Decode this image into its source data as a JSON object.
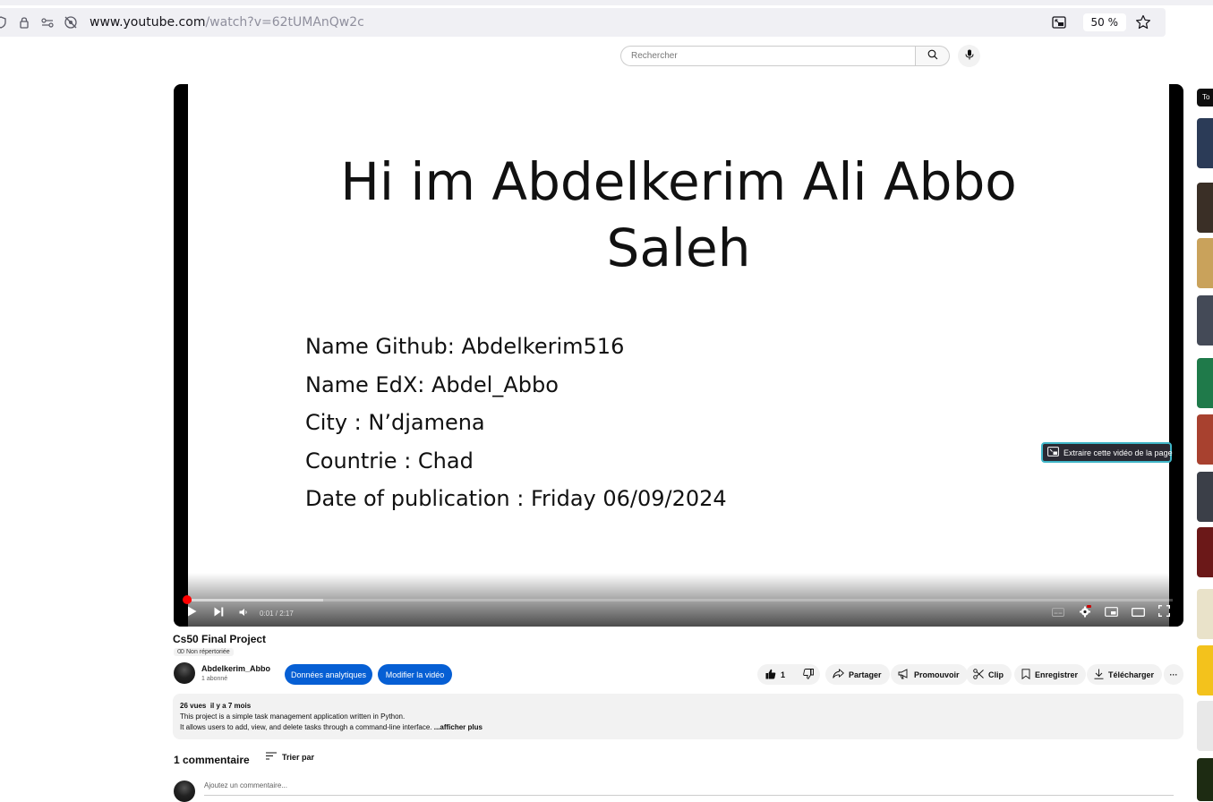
{
  "browser": {
    "url_host": "www.youtube.com",
    "url_path": "/watch?v=62tUMAnQw2c",
    "zoom": "50 %"
  },
  "masthead": {
    "search_placeholder": "Rechercher"
  },
  "player": {
    "slide_title_line1": "Hi im Abdelkerim Ali Abbo",
    "slide_title_line2": "Saleh",
    "slide_lines": [
      "Name Github: Abdelkerim516",
      "Name EdX: Abdel_Abbo",
      "City : N’djamena",
      "Countrie : Chad",
      "Date of publication : Friday 06/09/2024"
    ],
    "time": "0:01 / 2:17",
    "played_fraction": 0.007,
    "buffered_fraction": 0.14,
    "pip_tooltip": "Extraire cette vidéo de la page"
  },
  "video": {
    "title": "Cs50 Final Project",
    "visibility": "Non répertoriée",
    "channel_name": "Abdelkerim_Abbo",
    "subscribers": "1 abonné",
    "analytics_button": "Données analytiques",
    "edit_button": "Modifier la vidéo",
    "likes": "1",
    "share_label": "Partager",
    "promote_label": "Promouvoir",
    "clip_label": "Clip",
    "save_label": "Enregistrer",
    "download_label": "Télécharger",
    "more_label": "···"
  },
  "description": {
    "views": "26 vues",
    "date": "il y a 7 mois",
    "line1": "This project is a simple task management application written in Python.",
    "line2": "It allows users to add, view, and delete tasks through a command-line interface.",
    "show_more": "...afficher plus"
  },
  "comments": {
    "count": "1 commentaire",
    "sort_label": "Trier par",
    "input_placeholder": "Ajoutez un commentaire..."
  },
  "sidebar": {
    "chip_label": "To",
    "thumbnail_colors": [
      "#2b3b57",
      "#3a2f26",
      "#c9a25b",
      "#444a57",
      "#1f7a4a",
      "#a8412f",
      "#3b3f48",
      "#6b1818",
      "#e9e2c9",
      "#f3c21c",
      "#e8e8e8",
      "#1d2b12"
    ]
  }
}
